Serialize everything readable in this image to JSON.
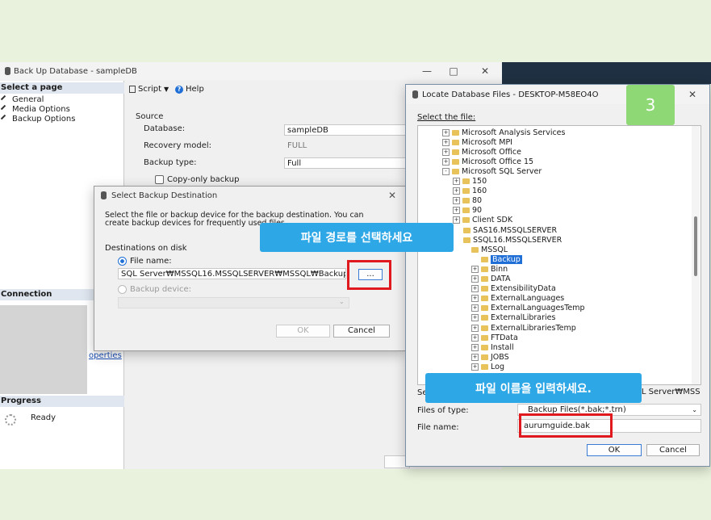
{
  "main_window": {
    "title": "Back Up Database - sampleDB",
    "select_page_header": "Select a page",
    "nav_items": [
      "General",
      "Media Options",
      "Backup Options"
    ],
    "toolbar": {
      "script_label": "Script",
      "help_label": "Help"
    },
    "source_label": "Source",
    "database_label": "Database:",
    "database_value": "sampleDB",
    "recovery_label": "Recovery model:",
    "recovery_value": "FULL",
    "backup_type_label": "Backup type:",
    "backup_type_value": "Full",
    "copy_only_label": "Copy-only backup",
    "connection_header": "Connection",
    "properties_link": "operties",
    "progress_header": "Progress",
    "progress_status": "Ready"
  },
  "select_backup_dialog": {
    "title": "Select Backup Destination",
    "description": "Select the file or backup device for the backup destination. You can create backup devices for frequently used files.",
    "destinations_label": "Destinations on disk",
    "file_name_label": "File name:",
    "file_path": "SQL Server₩MSSQL16.MSSQLSERVER₩MSSQL₩Backup₩",
    "browse_label": "...",
    "backup_device_label": "Backup device:",
    "ok_label": "OK",
    "cancel_label": "Cancel"
  },
  "locate_dialog": {
    "title": "Locate Database Files - DESKTOP-M58EO4O",
    "select_file_label": "Select the file:",
    "tree": [
      {
        "label": "Microsoft Analysis Services"
      },
      {
        "label": "Microsoft MPI"
      },
      {
        "label": "Microsoft Office"
      },
      {
        "label": "Microsoft Office 15"
      },
      {
        "label": "Microsoft SQL Server"
      },
      {
        "label": "150"
      },
      {
        "label": "160"
      },
      {
        "label": "80"
      },
      {
        "label": "90"
      },
      {
        "label": "Client SDK"
      },
      {
        "label": "SAS16.MSSQLSERVER"
      },
      {
        "label": "SSQL16.MSSQLSERVER"
      },
      {
        "label": "MSSQL"
      },
      {
        "label": "Backup"
      },
      {
        "label": "Binn"
      },
      {
        "label": "DATA"
      },
      {
        "label": "ExtensibilityData"
      },
      {
        "label": "ExternalLanguages"
      },
      {
        "label": "ExternalLanguagesTemp"
      },
      {
        "label": "ExternalLibraries"
      },
      {
        "label": "ExternalLibrariesTemp"
      },
      {
        "label": "FTData"
      },
      {
        "label": "Install"
      },
      {
        "label": "JOBS"
      },
      {
        "label": "Log"
      }
    ],
    "selected_path_prefix": "Se",
    "selected_path_suffix": "QL Server₩MSS",
    "files_of_type_label": "Files of type:",
    "files_of_type_value": "Backup Files(*.bak;*.trn)",
    "file_name_label": "File name:",
    "file_name_value": "aurumguide.bak",
    "ok_label": "OK",
    "cancel_label": "Cancel"
  },
  "annotations": {
    "step_badge": "3",
    "callout_path": "파일 경로를 선택하세요",
    "callout_filename": "파일 이름을 입력하세요."
  },
  "colors": {
    "callout": "#2ea7e6",
    "badge": "#8fd876",
    "highlight": "#e0191e"
  }
}
